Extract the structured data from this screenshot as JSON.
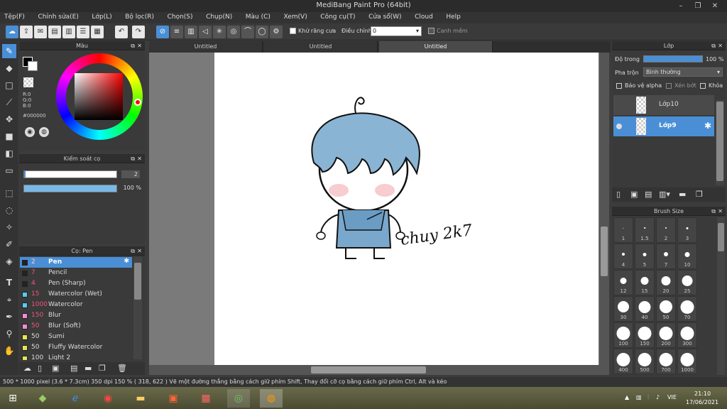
{
  "window": {
    "title": "MediBang Paint Pro (64bit)"
  },
  "menu": [
    "Tệp(F)",
    "Chỉnh sửa(E)",
    "Lớp(L)",
    "Bộ lọc(R)",
    "Chọn(S)",
    "Chụp(N)",
    "Màu (C)",
    "Xem(V)",
    "Công cụ(T)",
    "Cửa sổ(W)",
    "Cloud",
    "Help"
  ],
  "toolbar": {
    "antialias_label": "Khử răng cưa",
    "adjust_label": "Điều chỉnh",
    "adjust_value": "0",
    "edge_label": "Canh mềm"
  },
  "tabs": [
    "Untitled",
    "Untitled",
    "Untitled"
  ],
  "color_panel": {
    "title": "Màu",
    "rgb": [
      "R:0",
      "G:0",
      "B:0"
    ],
    "hex": "#000000",
    "hue_marker_color": "#ff0000"
  },
  "brush_control": {
    "title": "Kiểm soát cọ",
    "size_value": "2",
    "opacity_value": "100 %"
  },
  "brush_panel": {
    "title": "Cọ: Pen",
    "items": [
      {
        "size": "2",
        "name": "Pen",
        "color": "#222222"
      },
      {
        "size": "7",
        "name": "Pencil",
        "color": "#222222"
      },
      {
        "size": "4",
        "name": "Pen (Sharp)",
        "color": "#222222"
      },
      {
        "size": "15",
        "name": "Watercolor (Wet)",
        "color": "#5ac8f0"
      },
      {
        "size": "1000",
        "name": "Watercolor",
        "color": "#5ac8f0"
      },
      {
        "size": "150",
        "name": "Blur",
        "color": "#f08cd2"
      },
      {
        "size": "50",
        "name": "Blur (Soft)",
        "color": "#f08cd2"
      },
      {
        "size": "50",
        "name": "Sumi",
        "color": "#e6e650"
      },
      {
        "size": "50",
        "name": "Fluffy Watercolor",
        "color": "#e6e650"
      },
      {
        "size": "100",
        "name": "Light 2",
        "color": "#e6e650"
      }
    ]
  },
  "layer_panel": {
    "title": "Lớp",
    "opacity_label": "Độ trong",
    "opacity_value": "100 %",
    "opacity_fraction": 1.0,
    "blend_label": "Pha trộn",
    "blend_value": "Bình thường",
    "protect_alpha": "Bảo vệ alpha",
    "clipping": "Xén bớt",
    "lock": "Khóa",
    "layers": [
      "Lớp10",
      "Lớp9"
    ]
  },
  "brush_size_panel": {
    "title": "Brush Size",
    "sizes": [
      "1",
      "1.5",
      "2",
      "3",
      "4",
      "5",
      "7",
      "10",
      "12",
      "15",
      "20",
      "25",
      "30",
      "40",
      "50",
      "70",
      "100",
      "150",
      "200",
      "300",
      "400",
      "500",
      "700",
      "1000"
    ]
  },
  "canvas": {
    "signature": "chuy 2k7"
  },
  "status": {
    "text": "500 * 1000 pixel    (3.6 * 7.3cm)    350 dpi    150 %    ( 318, 622 )    Vẽ một đường thẳng bằng cách giữ phím Shift, Thay đổi cỡ cọ bằng cách giữ phím Ctrl, Alt và kéo"
  },
  "taskbar": {
    "language": "VIE",
    "time": "21:10",
    "date": "17/06/2021"
  },
  "colors": {
    "accent": "#4a8fd6",
    "hair": "#8ab4d4",
    "overalls": "#7aa8cc",
    "blush": "#f5c0c4"
  }
}
